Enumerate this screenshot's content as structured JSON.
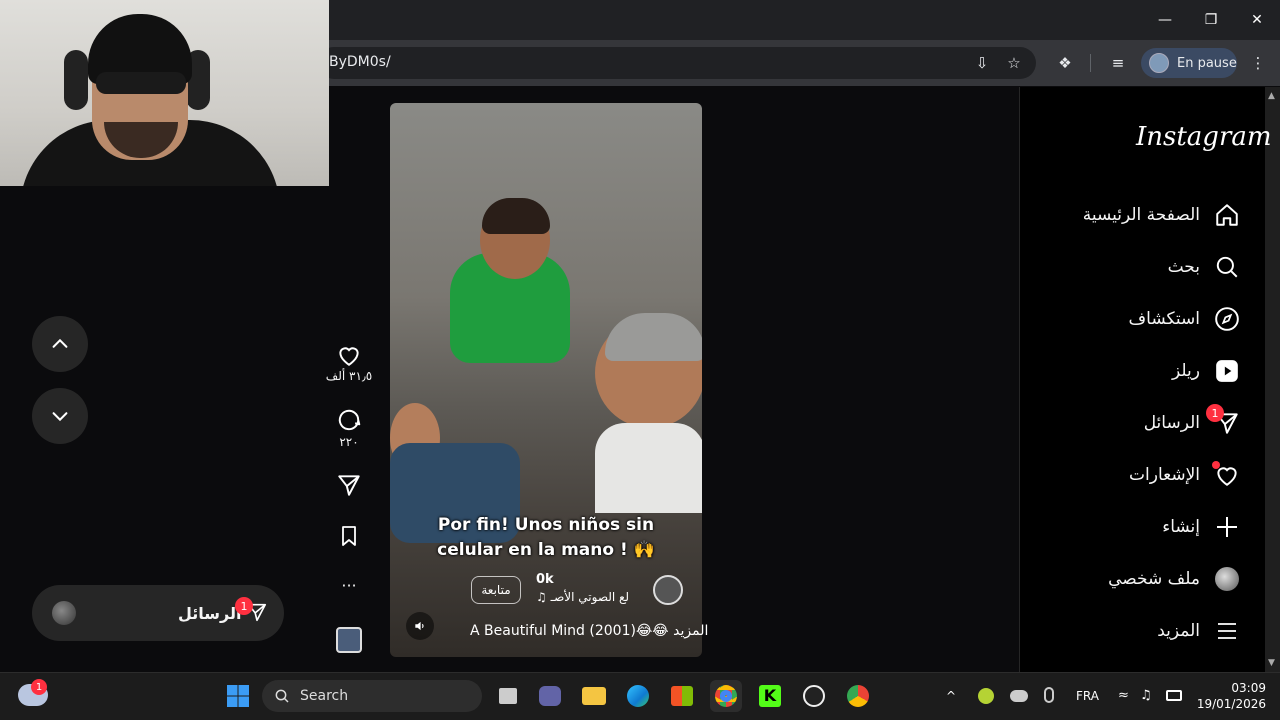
{
  "browser": {
    "url": "ByDM0s/",
    "profile_label": "En pause"
  },
  "page": {
    "nav_up_icon": "chevron-up-icon",
    "nav_down_icon": "chevron-down-icon",
    "messages_float": {
      "label": "الرسائل",
      "badge": "1"
    }
  },
  "reel": {
    "caption": "Por fin! Unos niños sin celular en la mano ! 🙌",
    "author": "0k",
    "audio": "♫ لع الصوتي الأصـ",
    "follow_label": "متابعة",
    "description": "A Beautiful Mind (2001)😂😂 المزيد",
    "actions": {
      "likes": "٣١٫٥ ألف",
      "comments": "٢٢٠",
      "more": "···"
    }
  },
  "sidebar": {
    "logo": "Instagram",
    "items": [
      {
        "label": "الصفحة الرئيسية",
        "icon": "home-icon"
      },
      {
        "label": "بحث",
        "icon": "search-icon"
      },
      {
        "label": "استكشاف",
        "icon": "compass-icon"
      },
      {
        "label": "ريلز",
        "icon": "reels-icon"
      },
      {
        "label": "الرسائل",
        "icon": "messages-icon",
        "badge": "1"
      },
      {
        "label": "الإشعارات",
        "icon": "heart-icon"
      },
      {
        "label": "إنشاء",
        "icon": "plus-icon"
      },
      {
        "label": "ملف شخصي",
        "icon": "profile-avatar-icon"
      },
      {
        "label": "المزيد",
        "icon": "menu-icon"
      }
    ]
  },
  "taskbar": {
    "search_label": "Search",
    "weather_badge": "1",
    "language": "FRA",
    "time": "03:09",
    "date": "19/01/2026"
  }
}
